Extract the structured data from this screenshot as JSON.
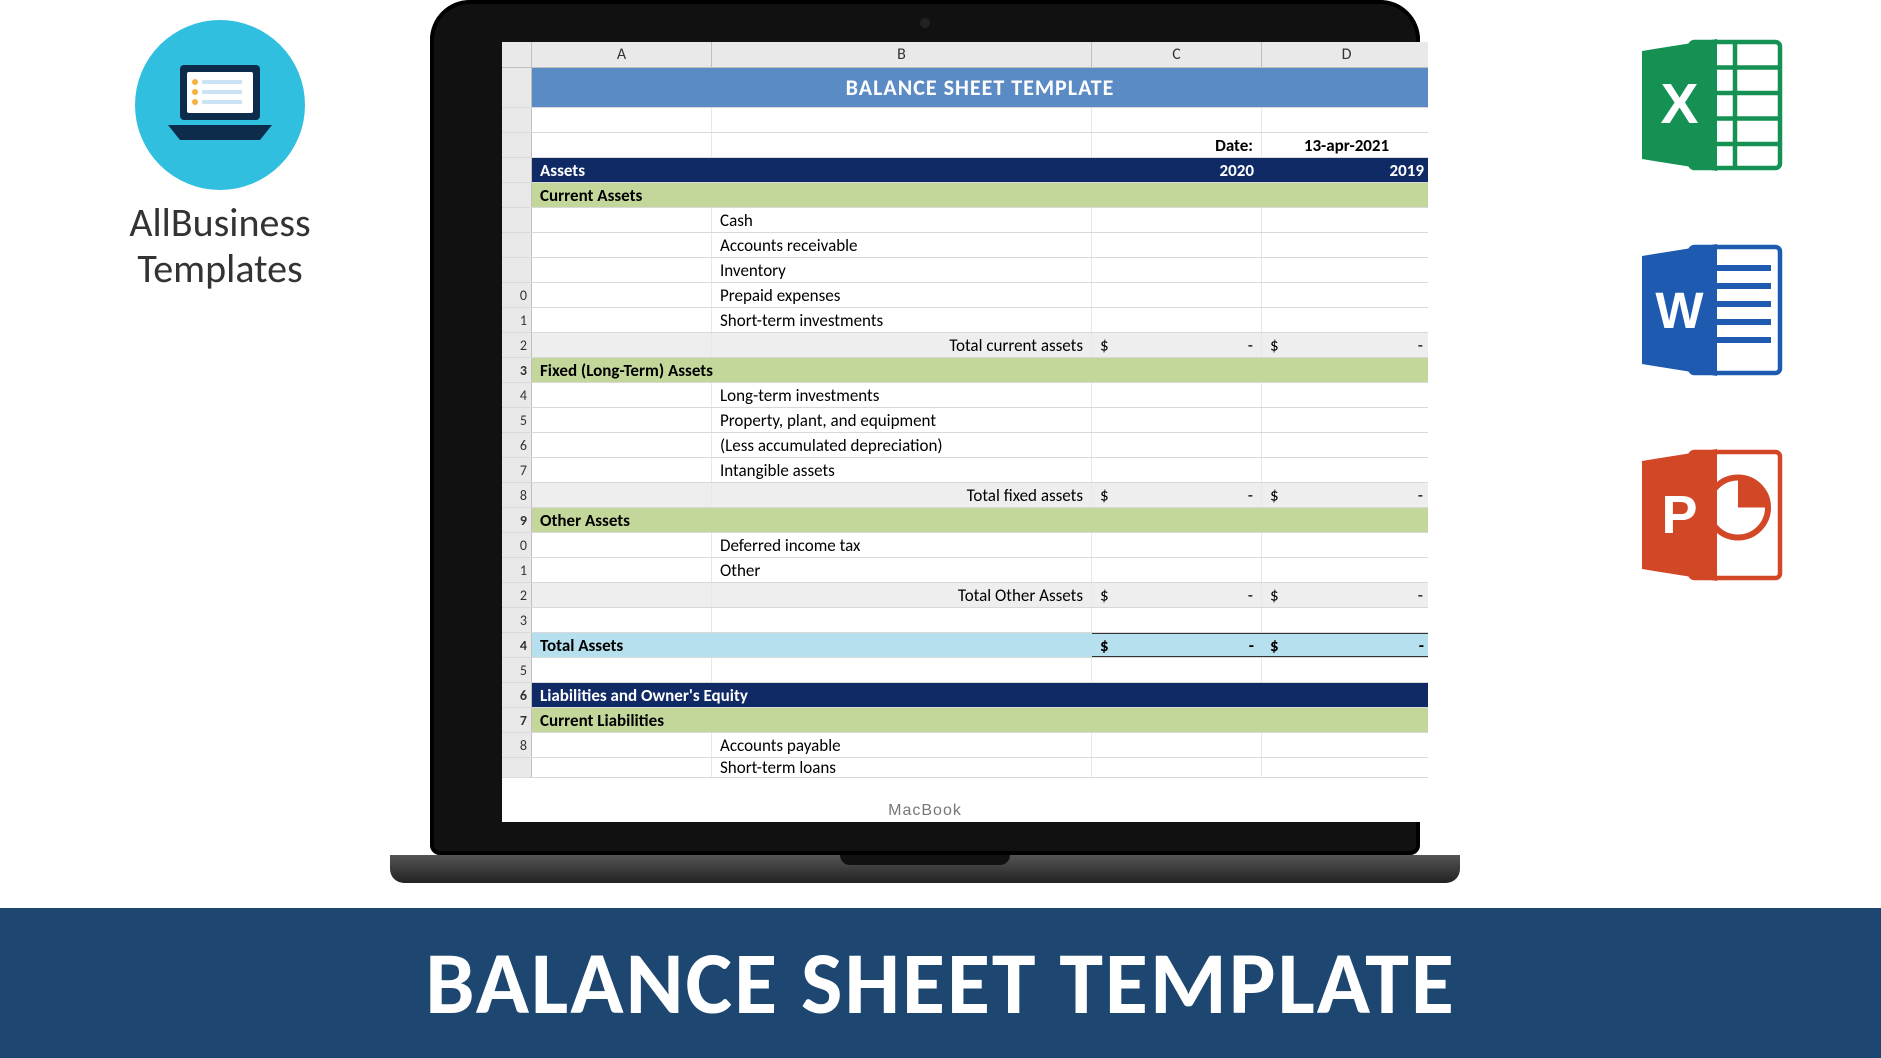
{
  "brand": {
    "line1": "AllBusiness",
    "line2": "Templates"
  },
  "banner": {
    "text": "BALANCE SHEET TEMPLATE"
  },
  "laptop": {
    "label": "MacBook"
  },
  "icons": {
    "excel": "excel-icon",
    "word": "word-icon",
    "powerpoint": "powerpoint-icon"
  },
  "sheet": {
    "columns": [
      "A",
      "B",
      "C",
      "D"
    ],
    "title": "BALANCE SHEET TEMPLATE",
    "date_label": "Date:",
    "date_value": "13-apr-2021",
    "section1": {
      "label": "Assets",
      "year1": "2020",
      "year2": "2019"
    },
    "sub1": "Current Assets",
    "items1": [
      "Cash",
      "Accounts receivable",
      "Inventory",
      "Prepaid expenses",
      "Short-term investments"
    ],
    "total1": "Total current assets",
    "sub2": "Fixed (Long-Term) Assets",
    "items2": [
      "Long-term investments",
      "Property, plant, and equipment",
      "(Less accumulated depreciation)",
      "Intangible assets"
    ],
    "total2": "Total fixed assets",
    "sub3": "Other Assets",
    "items3": [
      "Deferred income tax",
      "Other"
    ],
    "total3": "Total Other Assets",
    "grandtotal": "Total Assets",
    "section2": "Liabilities and Owner's Equity",
    "sub4": "Current Liabilities",
    "items4": [
      "Accounts payable",
      "Short-term loans"
    ],
    "money": {
      "symbol": "$",
      "dash": "-"
    },
    "rownums": [
      "",
      "",
      "",
      "",
      "",
      "",
      "",
      "0",
      "1",
      "2",
      "3",
      "4",
      "5",
      "6",
      "7",
      "8",
      "9",
      "0",
      "1",
      "2",
      "3",
      "4",
      "5",
      "6",
      "7",
      "8",
      ""
    ]
  }
}
